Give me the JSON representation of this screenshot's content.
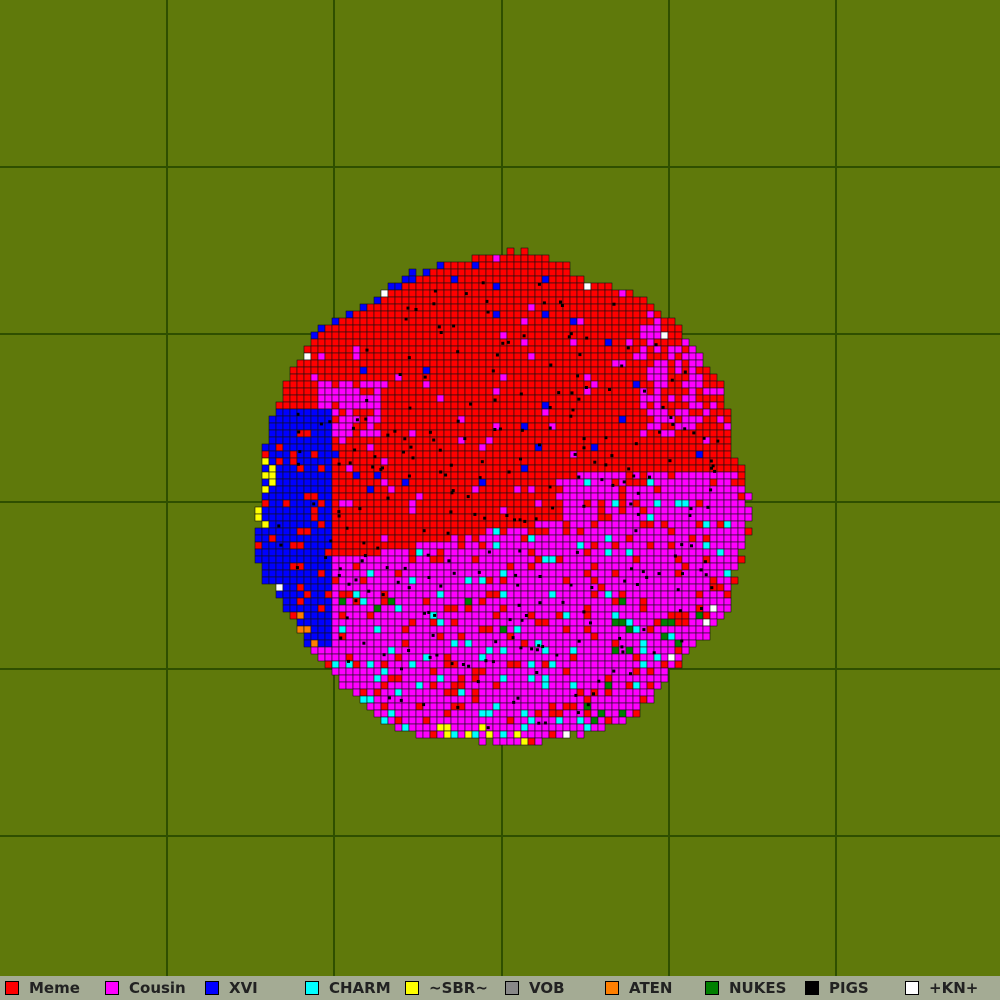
{
  "map": {
    "background_color": "#5f790b",
    "grid_line_color": "#2f4f00",
    "tile_outline_color": "#111111"
  },
  "legend": [
    {
      "name": "Meme",
      "color": "#ff0000"
    },
    {
      "name": "Cousin",
      "color": "#ff00ff"
    },
    {
      "name": "XVI",
      "color": "#0000ff"
    },
    {
      "name": "CHARM",
      "color": "#00ffff"
    },
    {
      "name": "~SBR~",
      "color": "#ffff00"
    },
    {
      "name": "VOB",
      "color": "#888888"
    },
    {
      "name": "ATEN",
      "color": "#ff7f00"
    },
    {
      "name": "NUKES",
      "color": "#007f00"
    },
    {
      "name": "PIGS",
      "color": "#000000"
    },
    {
      "name": "+KN+",
      "color": "#ffffff"
    }
  ]
}
